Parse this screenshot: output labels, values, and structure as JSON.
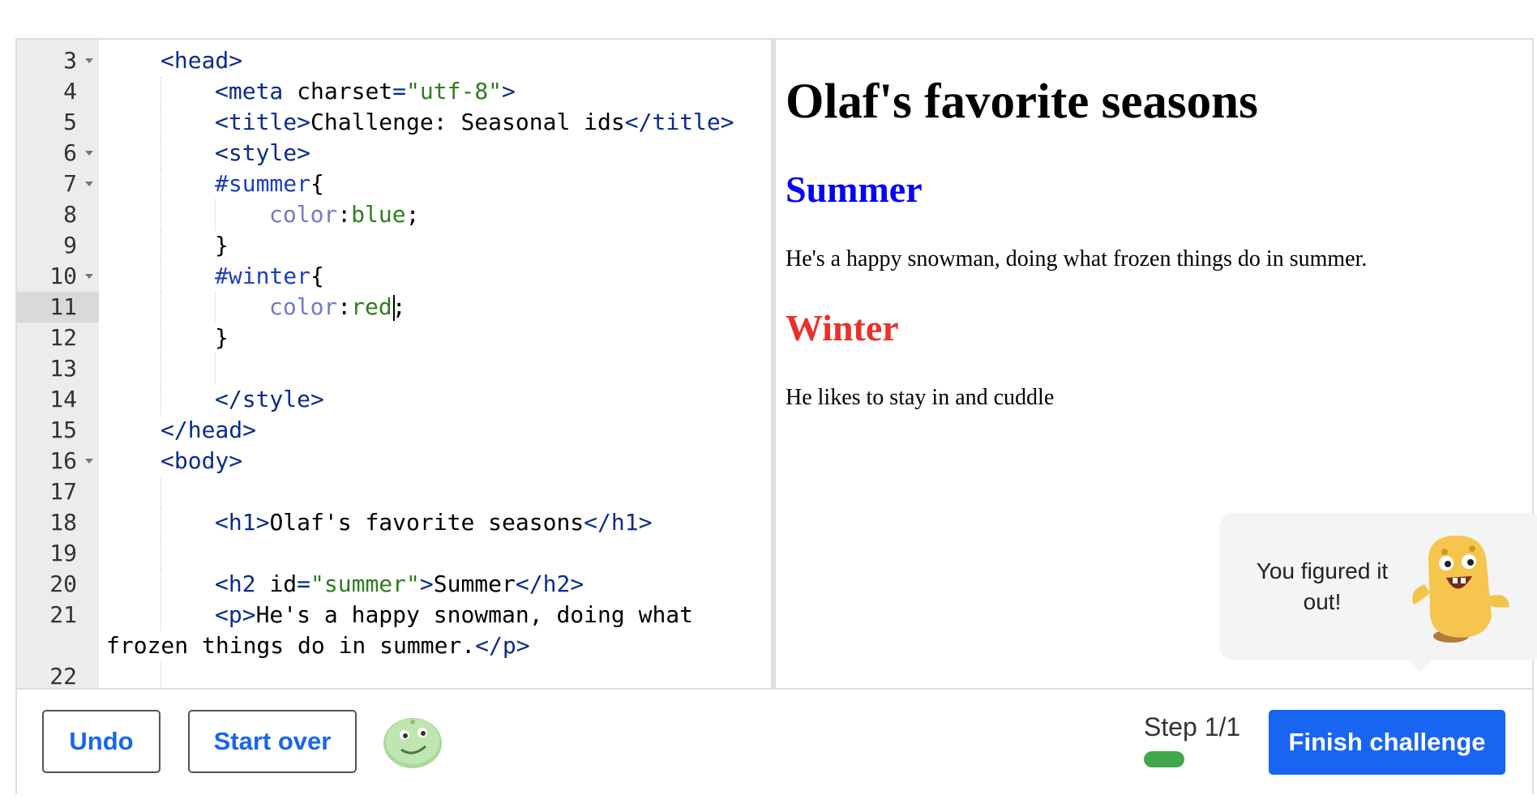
{
  "editor": {
    "lines": [
      {
        "n": "3",
        "fold": true,
        "indent": 1,
        "tokens": [
          [
            "tag",
            "<head>"
          ]
        ]
      },
      {
        "n": "4",
        "indent": 2,
        "tokens": [
          [
            "tag",
            "<meta "
          ],
          [
            "attr",
            "charset"
          ],
          [
            "tag",
            "="
          ],
          [
            "str",
            "\"utf-8\""
          ],
          [
            "tag",
            ">"
          ]
        ]
      },
      {
        "n": "5",
        "indent": 2,
        "tokens": [
          [
            "tag",
            "<title>"
          ],
          [
            "text",
            "Challenge: Seasonal ids"
          ],
          [
            "tag",
            "</title>"
          ]
        ]
      },
      {
        "n": "6",
        "fold": true,
        "indent": 2,
        "tokens": [
          [
            "tag",
            "<style>"
          ]
        ]
      },
      {
        "n": "7",
        "fold": true,
        "indent": 2,
        "tokens": [
          [
            "sel",
            "#summer"
          ],
          [
            "text",
            "{"
          ]
        ]
      },
      {
        "n": "8",
        "indent": 3,
        "tokens": [
          [
            "prop",
            "color"
          ],
          [
            "text",
            ":"
          ],
          [
            "val",
            "blue"
          ],
          [
            "text",
            ";"
          ]
        ]
      },
      {
        "n": "9",
        "indent": 2,
        "tokens": [
          [
            "text",
            "}"
          ]
        ]
      },
      {
        "n": "10",
        "fold": true,
        "indent": 2,
        "tokens": [
          [
            "sel",
            "#winter"
          ],
          [
            "text",
            "{"
          ]
        ]
      },
      {
        "n": "11",
        "active": true,
        "indent": 3,
        "tokens": [
          [
            "prop",
            "color"
          ],
          [
            "text",
            ":"
          ],
          [
            "val",
            "red"
          ],
          [
            "caret",
            ""
          ],
          [
            "text",
            ";"
          ]
        ]
      },
      {
        "n": "12",
        "indent": 2,
        "tokens": [
          [
            "text",
            "}"
          ]
        ]
      },
      {
        "n": "13",
        "indent": 3,
        "tokens": []
      },
      {
        "n": "14",
        "indent": 2,
        "tokens": [
          [
            "tag",
            "</style>"
          ]
        ]
      },
      {
        "n": "15",
        "indent": 1,
        "tokens": [
          [
            "tag",
            "</head>"
          ]
        ]
      },
      {
        "n": "16",
        "fold": true,
        "indent": 1,
        "tokens": [
          [
            "tag",
            "<body>"
          ]
        ]
      },
      {
        "n": "17",
        "indent": 2,
        "tokens": []
      },
      {
        "n": "18",
        "indent": 2,
        "tokens": [
          [
            "tag",
            "<h1>"
          ],
          [
            "text",
            "Olaf's favorite seasons"
          ],
          [
            "tag",
            "</h1>"
          ]
        ]
      },
      {
        "n": "19",
        "indent": 2,
        "tokens": []
      },
      {
        "n": "20",
        "indent": 2,
        "tokens": [
          [
            "tag",
            "<h2 "
          ],
          [
            "attr",
            "id"
          ],
          [
            "tag",
            "="
          ],
          [
            "str",
            "\"summer\""
          ],
          [
            "tag",
            ">"
          ],
          [
            "text",
            "Summer"
          ],
          [
            "tag",
            "</h2>"
          ]
        ]
      },
      {
        "n": "21",
        "indent": 2,
        "tokens": [
          [
            "tag",
            "<p>"
          ],
          [
            "text",
            "He's a happy snowman, doing what"
          ]
        ]
      },
      {
        "n": "",
        "indent": 0,
        "tokens": [
          [
            "text",
            "frozen things do in summer."
          ],
          [
            "tag",
            "</p>"
          ]
        ]
      },
      {
        "n": "22",
        "indent": 2,
        "tokens": []
      }
    ]
  },
  "preview": {
    "h1": "Olaf's favorite seasons",
    "summer_heading": "Summer",
    "summer_text": "He's a happy snowman, doing what frozen things do in summer.",
    "winter_heading": "Winter",
    "winter_text": "He likes to stay in and cuddle",
    "summer_color": "#0000ff",
    "winter_color": "#e8322a"
  },
  "tip": {
    "message": "You figured it out!",
    "icon": "yellow-monster-icon"
  },
  "toolbar": {
    "undo_label": "Undo",
    "start_over_label": "Start over",
    "avatar_icon": "green-avatar-icon",
    "step_label": "Step 1/1",
    "progress": 1.0,
    "progress_color": "#3ea84a",
    "finish_label": "Finish challenge",
    "accent_color": "#1865f2"
  }
}
